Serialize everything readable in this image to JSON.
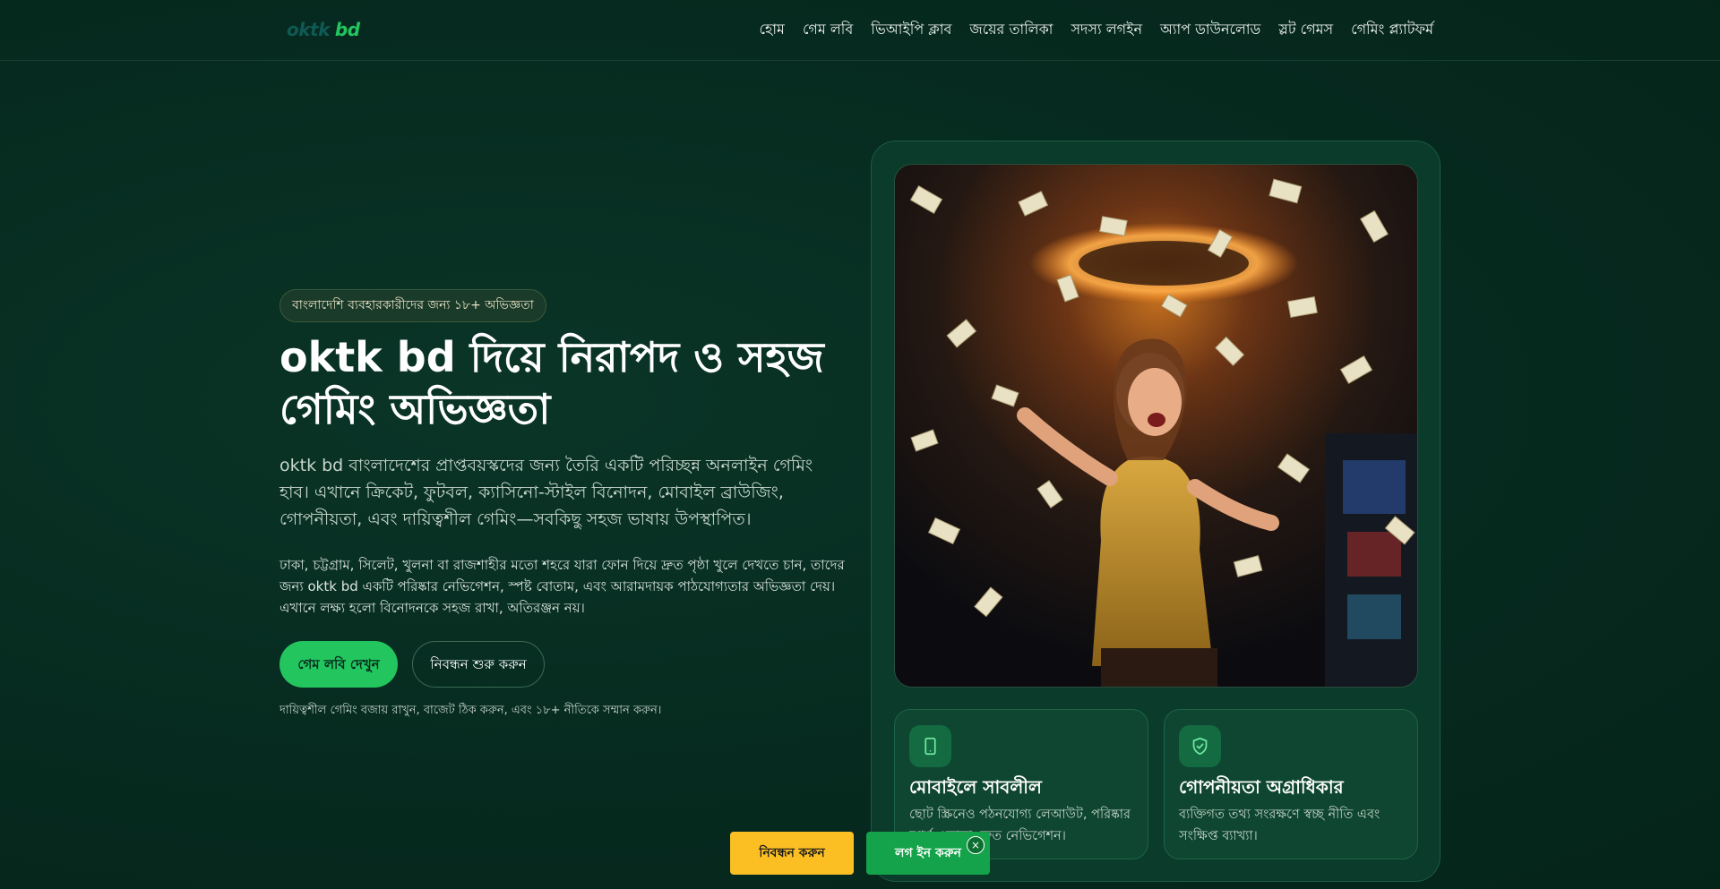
{
  "header": {
    "logo_part1": "oktk",
    "logo_part2": "bd",
    "nav": [
      {
        "label": "হোম"
      },
      {
        "label": "গেম লবি"
      },
      {
        "label": "ভিআইপি ক্লাব"
      },
      {
        "label": "জয়ের তালিকা"
      },
      {
        "label": "সদস্য লগইন"
      },
      {
        "label": "অ্যাপ ডাউনলোড"
      },
      {
        "label": "স্লট গেমস"
      },
      {
        "label": "গেমিং প্ল্যাটফর্ম"
      }
    ]
  },
  "hero": {
    "badge": "বাংলাদেশি ব্যবহারকারীদের জন্য ১৮+ অভিজ্ঞতা",
    "title": "oktk bd দিয়ে নিরাপদ ও সহজ গেমিং অভিজ্ঞতা",
    "lead": "oktk bd বাংলাদেশের প্রাপ্তবয়স্কদের জন্য তৈরি একটি পরিচ্ছন্ন অনলাইন গেমিং হাব। এখানে ক্রিকেট, ফুটবল, ক্যাসিনো-স্টাইল বিনোদন, মোবাইল ব্রাউজিং, গোপনীয়তা, এবং দায়িত্বশীল গেমিং—সবকিছু সহজ ভাষায় উপস্থাপিত।",
    "paragraph": "ঢাকা, চট্টগ্রাম, সিলেট, খুলনা বা রাজশাহীর মতো শহরে যারা ফোন দিয়ে দ্রুত পৃষ্ঠা খুলে দেখতে চান, তাদের জন্য oktk bd একটি পরিষ্কার নেভিগেশন, স্পষ্ট বোতাম, এবং আরামদায়ক পাঠযোগ্যতার অভিজ্ঞতা দেয়। এখানে লক্ষ্য হলো বিনোদনকে সহজ রাখা, অতিরঞ্জন নয়।",
    "primary_button": "গেম লবি দেখুন",
    "secondary_button": "নিবন্ধন শুরু করুন",
    "note": "দায়িত্বশীল গেমিং বজায় রাখুন, বাজেট ঠিক করুন, এবং ১৮+ নীতিকে সম্মান করুন।"
  },
  "features": [
    {
      "icon": "smartphone-icon",
      "title": "মোবাইলে সাবলীল",
      "desc": "ছোট স্ক্রিনেও পঠনযোগ্য লেআউট, পরিষ্কার স্পর্শ এলাকা, দ্রুত নেভিগেশন।"
    },
    {
      "icon": "shield-check-icon",
      "title": "গোপনীয়তা অগ্রাধিকার",
      "desc": "ব্যক্তিগত তথ্য সংরক্ষণে স্বচ্ছ নীতি এবং সংক্ষিপ্ত ব্যাখ্যা।"
    }
  ],
  "sticky": {
    "register": "নিবন্ধন করুন",
    "login": "লগ ইন করুন",
    "close": "×"
  },
  "colors": {
    "background": "#062a1f",
    "accent_green": "#22c55e",
    "accent_yellow": "#fbbf24"
  }
}
